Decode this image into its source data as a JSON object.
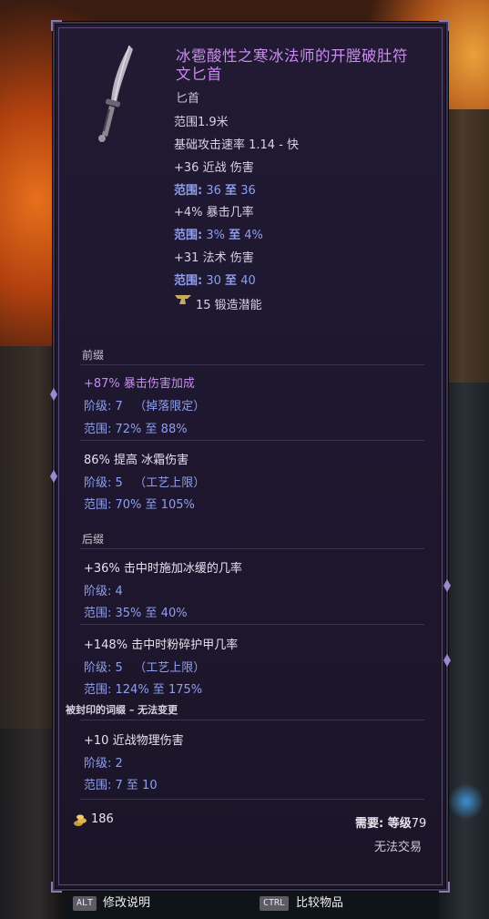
{
  "item": {
    "title": "冰雹酸性之寒冰法师的开膛破肚符文匕首",
    "type": "匕首",
    "base_stats": [
      {
        "text": "范围1.9米"
      },
      {
        "text": "基础攻击速率 1.14 - 快"
      }
    ],
    "implicits": [
      {
        "value": "+36 近战 伤害",
        "range_label": "范围:",
        "range_min": "36",
        "range_to": "至",
        "range_max": "36"
      },
      {
        "value": "+4% 暴击几率",
        "range_label": "范围:",
        "range_min": "3%",
        "range_to": "至",
        "range_max": "4%"
      },
      {
        "value": "+31 法术 伤害",
        "range_label": "范围:",
        "range_min": "30",
        "range_to": "至",
        "range_max": "40"
      }
    ],
    "forge_potential": "15 锻造潜能"
  },
  "prefixes": {
    "header": "前缀",
    "items": [
      {
        "text": "+87% 暴击伤害加成",
        "tier": "阶级: 7",
        "tier_note": "（掉落限定）",
        "range": "范围: 72% 至 88%"
      },
      {
        "text": "86% 提高 冰霜伤害",
        "tier": "阶级: 5",
        "tier_note": "（工艺上限）",
        "range": "范围: 70% 至 105%"
      }
    ]
  },
  "suffixes": {
    "header": "后缀",
    "items": [
      {
        "text": "+36% 击中时施加冰缓的几率",
        "tier": "阶级: 4",
        "tier_note": "",
        "range": "范围: 35% 至 40%"
      },
      {
        "text": "+148% 击中时粉碎护甲几率",
        "tier": "阶级: 5",
        "tier_note": "（工艺上限）",
        "range": "范围: 124% 至 175%"
      }
    ]
  },
  "sealed": {
    "header": "被封印的词缀 – 无法变更",
    "item": {
      "text": "+10 近战物理伤害",
      "tier": "阶级: 2",
      "range": "范围: 7 至 10"
    }
  },
  "footer": {
    "gold_value": "186",
    "requirement_label": "需要: 等级",
    "requirement_level": "79",
    "untradable": "无法交易"
  },
  "hints": [
    {
      "key": "ALT",
      "label": "修改说明"
    },
    {
      "key": "CTRL",
      "label": "比较物品"
    }
  ],
  "colors": {
    "title": "#c98bf0",
    "range": "#8f9ff0",
    "panel": "#1e1730"
  },
  "icons": {
    "weapon": "dagger-icon",
    "forge": "anvil-icon",
    "gold": "gold-coins-icon"
  }
}
